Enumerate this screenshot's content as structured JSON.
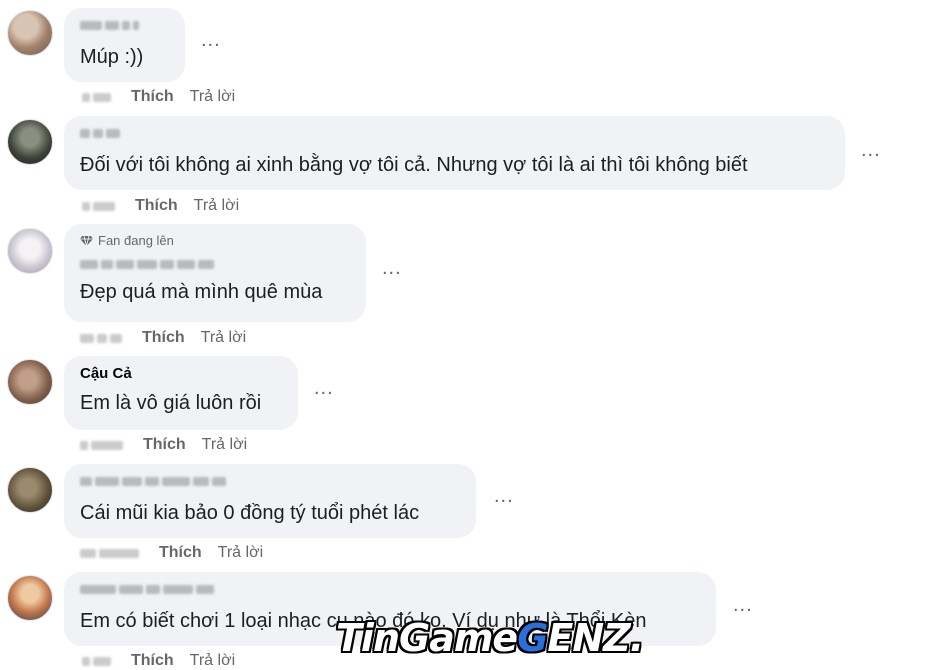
{
  "actions": {
    "like_label": "Thích",
    "reply_label": "Trả lời"
  },
  "more_label": "...",
  "comments": [
    {
      "author": "",
      "text": "Múp :))",
      "badge": ""
    },
    {
      "author": "",
      "text": "Đối với tôi không ai xinh bằng vợ tôi cả. Nhưng vợ tôi là ai thì tôi không biết",
      "badge": ""
    },
    {
      "author": "",
      "text": "Đẹp quá mà mình quê mùa",
      "badge": "Fan đang lên"
    },
    {
      "author": "Cậu Cả",
      "text": "Em là vô giá luôn rồi",
      "badge": ""
    },
    {
      "author": "",
      "text": "Cái mũi kia bảo 0 đồng tý tuổi phét lác",
      "badge": ""
    },
    {
      "author": "",
      "text": "Em có biết chơi 1 loại nhạc cụ nào đó ko. Ví dụ như là Thổi Kèn",
      "badge": ""
    }
  ],
  "watermark": {
    "part1": "TinGame",
    "part2": "G",
    "part3": "ENZ."
  },
  "colors": {
    "bubble": "#f0f2f5",
    "meta": "#65676b",
    "text": "#1c1e21"
  }
}
